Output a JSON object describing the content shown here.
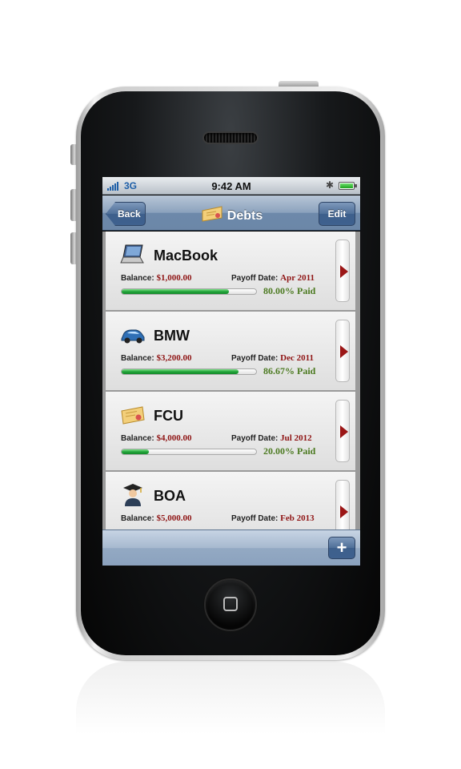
{
  "status_bar": {
    "carrier": "3G",
    "time": "9:42 AM"
  },
  "nav": {
    "back_label": "Back",
    "title": "Debts",
    "edit_label": "Edit",
    "title_icon": "certificate-icon"
  },
  "debts": [
    {
      "name": "MacBook",
      "icon": "laptop-icon",
      "balance_label": "Balance:",
      "balance": "$1,000.00",
      "payoff_label": "Payoff Date:",
      "payoff_date": "Apr 2011",
      "paid_text": "80.00% Paid",
      "paid_fraction": 0.8
    },
    {
      "name": "BMW",
      "icon": "car-icon",
      "balance_label": "Balance:",
      "balance": "$3,200.00",
      "payoff_label": "Payoff Date:",
      "payoff_date": "Dec 2011",
      "paid_text": "86.67% Paid",
      "paid_fraction": 0.8667
    },
    {
      "name": "FCU",
      "icon": "certificate-icon",
      "balance_label": "Balance:",
      "balance": "$4,000.00",
      "payoff_label": "Payoff Date:",
      "payoff_date": "Jul 2012",
      "paid_text": "20.00% Paid",
      "paid_fraction": 0.2
    },
    {
      "name": "BOA",
      "icon": "graduate-icon",
      "balance_label": "Balance:",
      "balance": "$5,000.00",
      "payoff_label": "Payoff Date:",
      "payoff_date": "Feb 2013",
      "paid_text": "",
      "paid_fraction": null
    }
  ],
  "toolbar": {
    "add_label": "+"
  },
  "colors": {
    "money_red": "#8f1414",
    "paid_green": "#4c7a21",
    "progress_green": "#22a53a",
    "nav_blue": "#6d89aa"
  }
}
